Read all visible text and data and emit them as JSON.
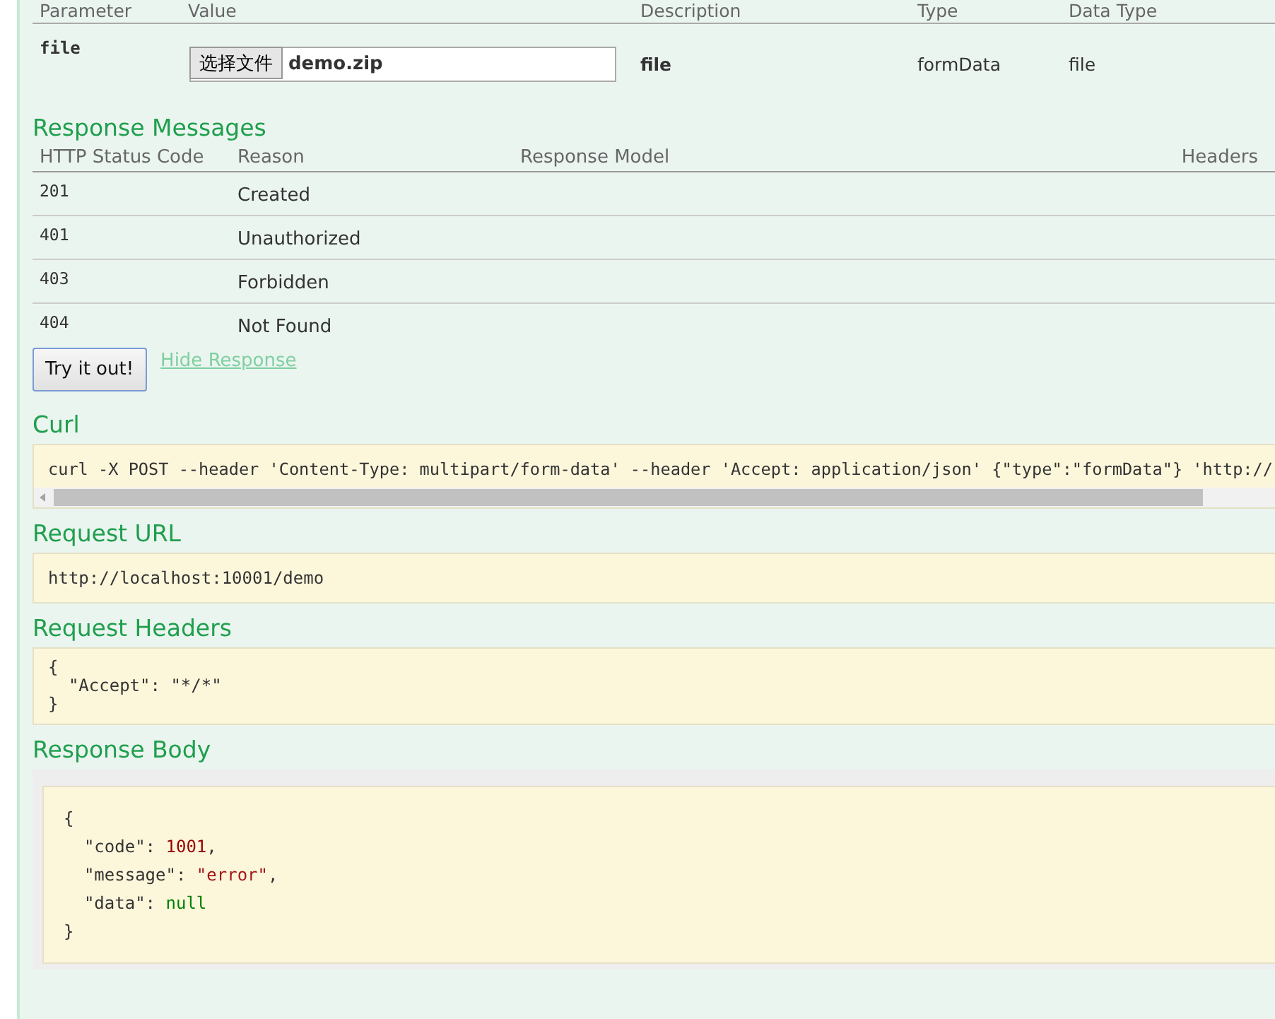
{
  "parameters": {
    "columns": [
      "Parameter",
      "Value",
      "Description",
      "Type",
      "Data Type"
    ],
    "rows": [
      {
        "name": "file",
        "file_button": "选择文件",
        "file_name": "demo.zip",
        "description": "file",
        "parameter_type": "formData",
        "data_type": "file"
      }
    ]
  },
  "response_messages": {
    "title": "Response Messages",
    "columns": [
      "HTTP Status Code",
      "Reason",
      "Response Model",
      "Headers"
    ],
    "rows": [
      {
        "code": "201",
        "reason": "Created"
      },
      {
        "code": "401",
        "reason": "Unauthorized"
      },
      {
        "code": "403",
        "reason": "Forbidden"
      },
      {
        "code": "404",
        "reason": "Not Found"
      }
    ]
  },
  "try_button": "Try it out!",
  "hide_link": "Hide Response",
  "curl": {
    "title": "Curl",
    "command": "curl -X POST --header 'Content-Type: multipart/form-data' --header 'Accept: application/json' {\"type\":\"formData\"} 'http://"
  },
  "request_url": {
    "title": "Request URL",
    "url": "http://localhost:10001/demo"
  },
  "request_headers": {
    "title": "Request Headers",
    "lines": [
      "{",
      "  \"Accept\": \"*/*\"",
      "}"
    ]
  },
  "response_body": {
    "title": "Response Body",
    "open": "{",
    "close": "}",
    "entries": [
      {
        "key": "\"code\": ",
        "value": "1001",
        "kind": "number",
        "tail": ","
      },
      {
        "key": "\"message\": ",
        "value": "\"error\"",
        "kind": "string",
        "tail": ","
      },
      {
        "key": "\"data\": ",
        "value": "null",
        "kind": "null"
      }
    ]
  }
}
